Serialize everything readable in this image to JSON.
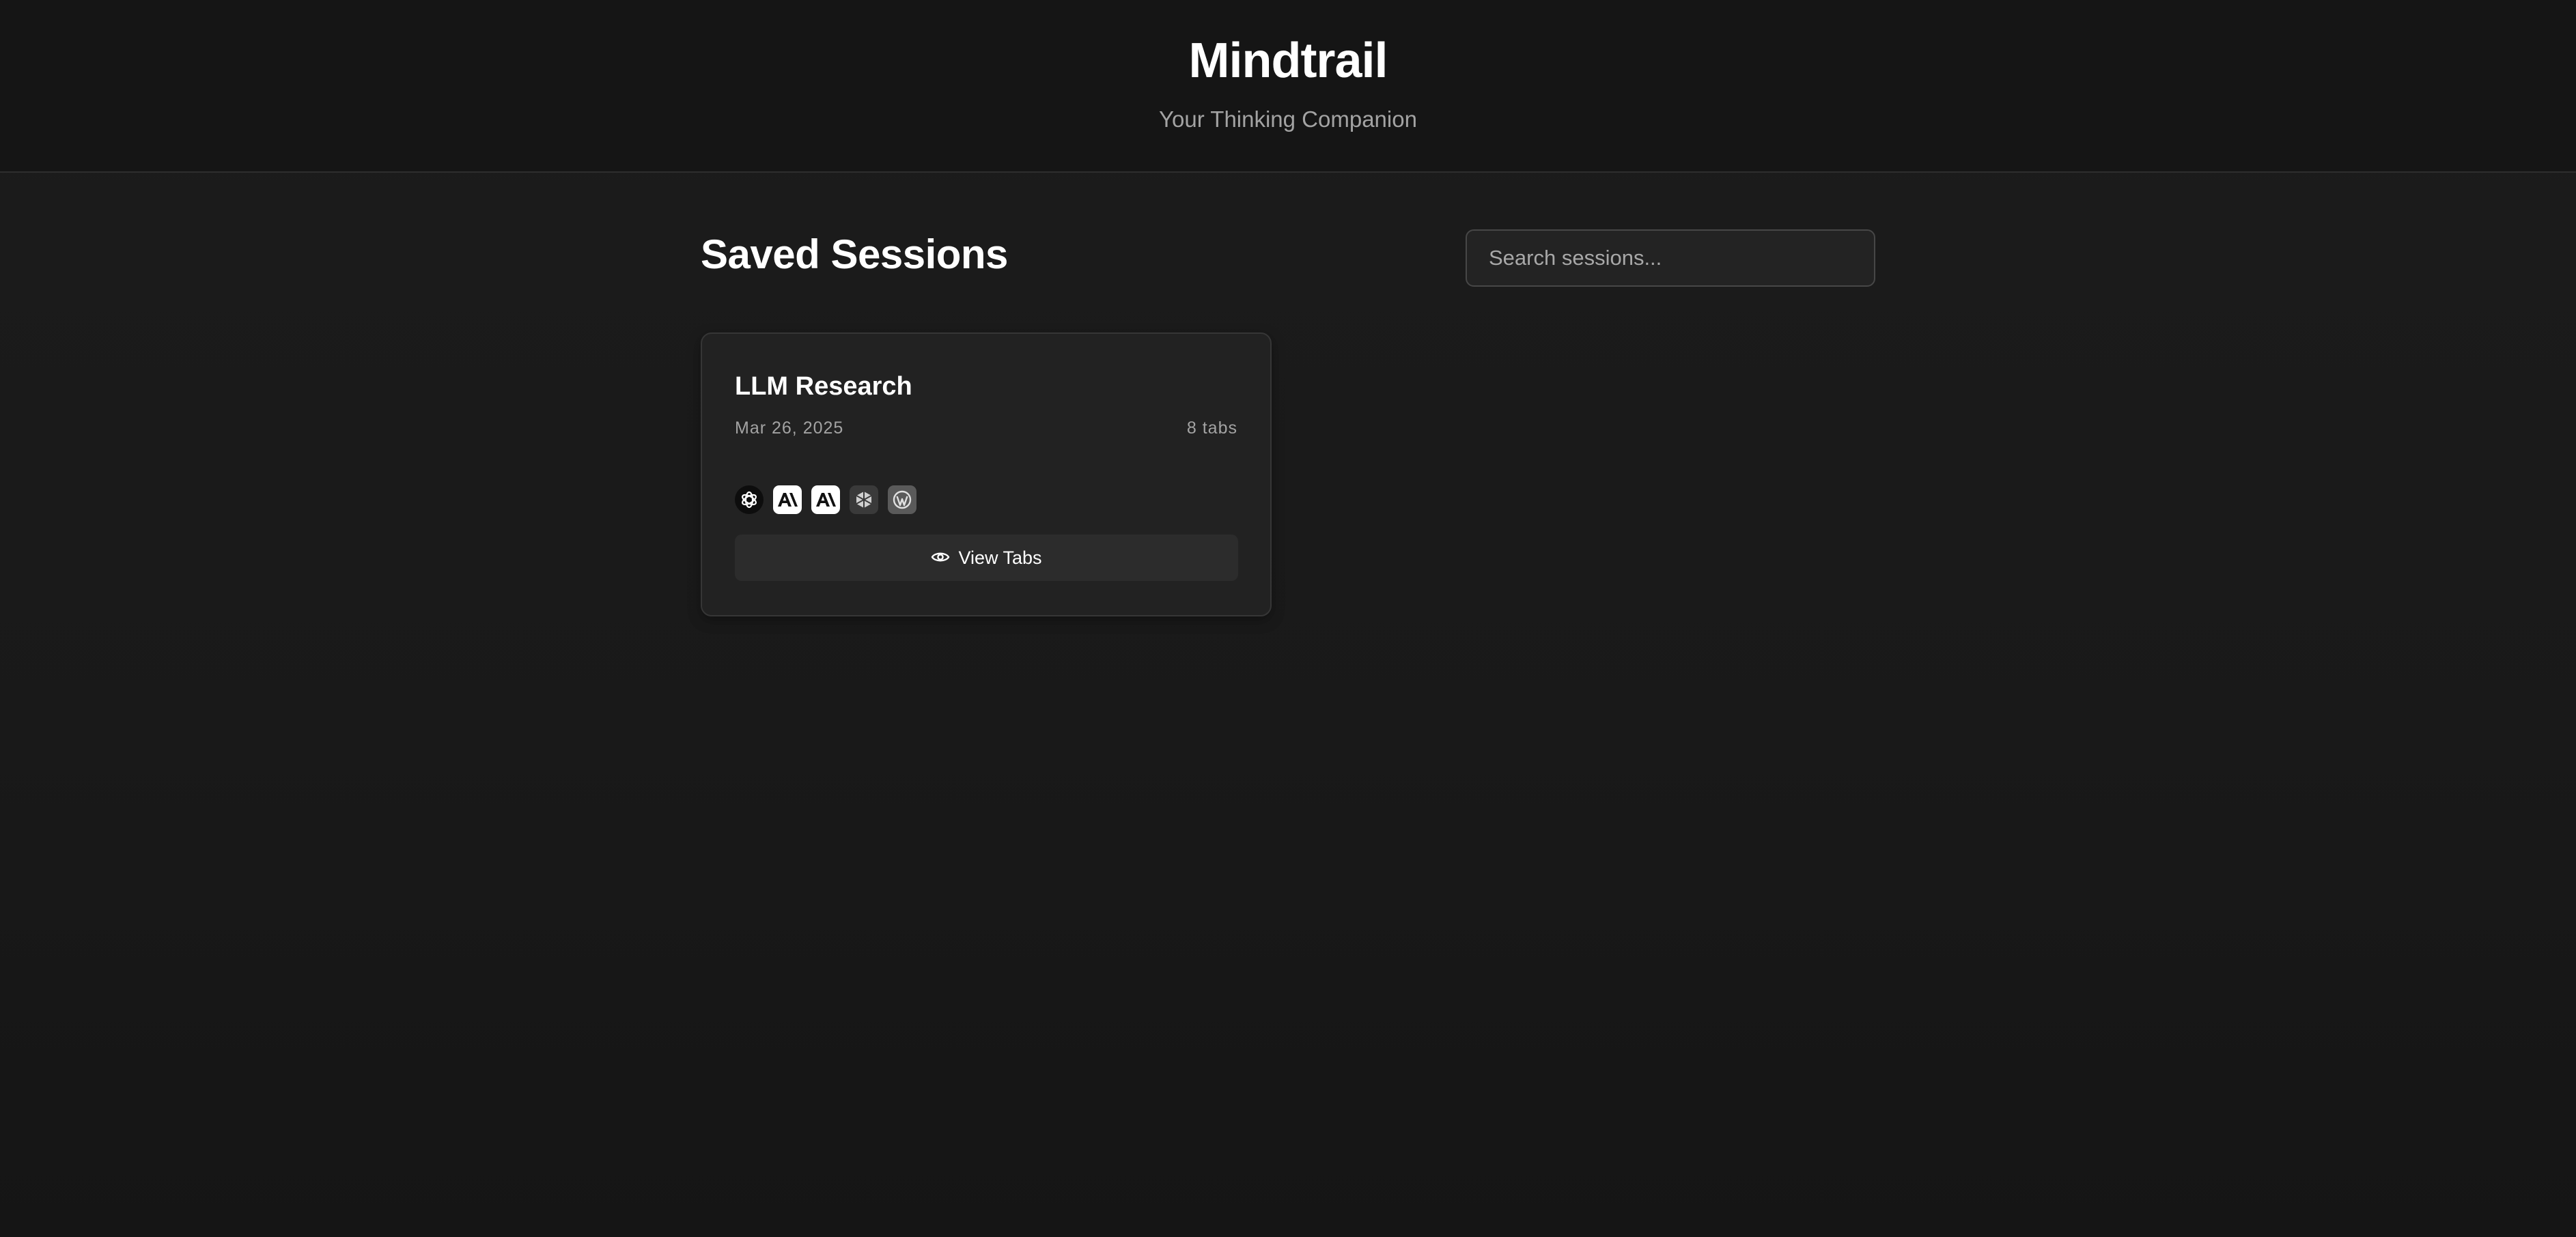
{
  "header": {
    "title": "Mindtrail",
    "subtitle": "Your Thinking Companion"
  },
  "main": {
    "page_title": "Saved Sessions",
    "search": {
      "placeholder": "Search sessions...",
      "value": ""
    },
    "sessions": [
      {
        "title": "LLM Research",
        "date": "Mar 26, 2025",
        "tab_count": "8 tabs",
        "favicons": [
          "openai-icon",
          "anthropic-icon",
          "anthropic-icon",
          "perplexity-icon",
          "wordpress-icon"
        ],
        "view_button_label": "View Tabs"
      }
    ]
  },
  "colors": {
    "background": "#191919",
    "card": "#222222",
    "button": "#2c2c2c",
    "muted_text": "#a3a3a3"
  }
}
